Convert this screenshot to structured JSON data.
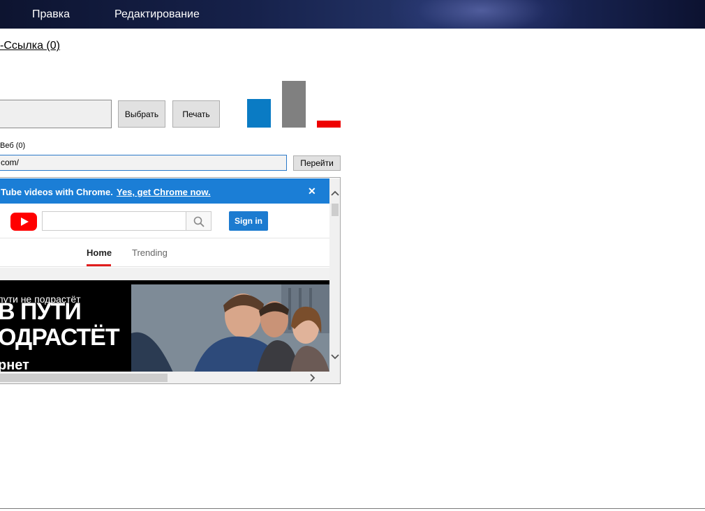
{
  "menu": {
    "items": [
      "Правка",
      "Редактирование"
    ]
  },
  "link_text": "-Ссылка (0)",
  "buttons": {
    "select": "Выбрать",
    "print": "Печать",
    "go": "Перейти"
  },
  "indicators": {
    "colors": [
      "#0a7bc4",
      "#808080",
      "#ee0000"
    ]
  },
  "web_label": "Веб (0)",
  "url_value": "com/",
  "browser": {
    "banner_text": "Tube videos with Chrome.",
    "banner_link": "Yes, get Chrome now.",
    "banner_close": "✕",
    "signin": "Sign in",
    "tabs": [
      "Home",
      "Trending"
    ],
    "promo": {
      "small": "пути не подрастёт",
      "big1": "В ПУТИ",
      "big2": "ОДРАСТЁТ",
      "brand": "рнет"
    }
  },
  "theme": {
    "banner_blue": "#1b7ed6",
    "yt_red": "#ff0000",
    "signin_blue": "#1c7bd0"
  },
  "icons": [
    "youtube-logo-icon",
    "search-icon",
    "close-icon",
    "chevron-up-icon",
    "chevron-down-icon",
    "chevron-right-icon"
  ]
}
